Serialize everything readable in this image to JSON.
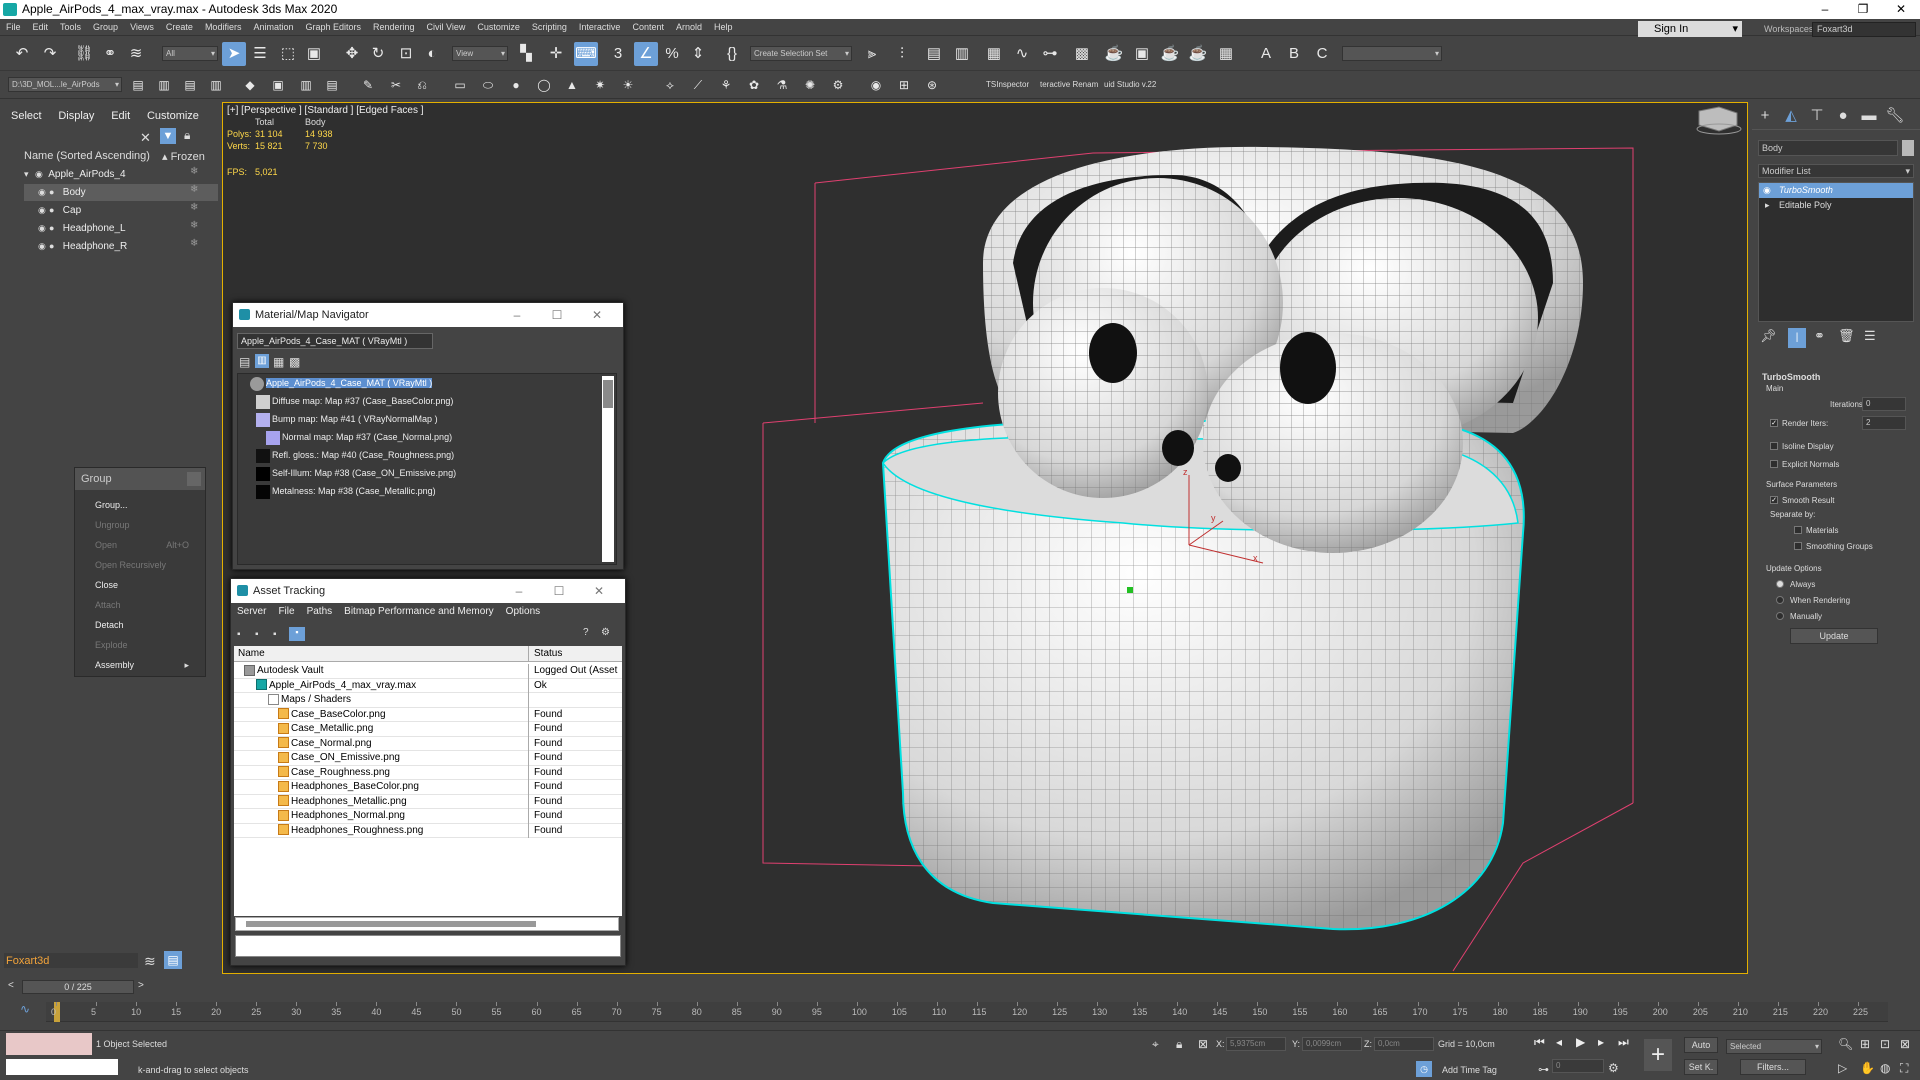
{
  "window": {
    "title": "Apple_AirPods_4_max_vray.max - Autodesk 3ds Max 2020",
    "minimize": "–",
    "restore": "❐",
    "close": "✕"
  },
  "menu": [
    "File",
    "Edit",
    "Tools",
    "Group",
    "Views",
    "Create",
    "Modifiers",
    "Animation",
    "Graph Editors",
    "Rendering",
    "Civil View",
    "Customize",
    "Scripting",
    "Interactive",
    "Content",
    "Arnold",
    "Help"
  ],
  "signin": "Sign In",
  "workspaces": {
    "label": "Workspaces:",
    "value": "Foxart3d"
  },
  "toolbar": {
    "filter": "All",
    "view": "View",
    "selection_set": "Create Selection Set",
    "path": "D:\\3D_MOL...le_AirPods",
    "plugins": [
      "TSInspector",
      "teractive Renam",
      "uid Studio v.22"
    ]
  },
  "scene_explorer": {
    "tabs": [
      "Select",
      "Display",
      "Edit",
      "Customize"
    ],
    "col_name": "Name (Sorted Ascending)",
    "col_frozen": "▴ Frozen",
    "items": [
      "Apple_AirPods_4",
      "Body",
      "Cap",
      "Headphone_L",
      "Headphone_R"
    ],
    "workspace": "Foxart3d"
  },
  "viewport": {
    "label": "[+] [Perspective ] [Standard ] [Edged Faces ]",
    "stats": {
      "total": "Total",
      "body": "Body",
      "polys_label": "Polys:",
      "polys_total": "31 104",
      "polys_body": "14 938",
      "verts_label": "Verts:",
      "verts_total": "15 821",
      "verts_body": "7 730",
      "fps_label": "FPS:",
      "fps": "5,021"
    },
    "axes": {
      "x": "x",
      "y": "y",
      "z": "z"
    }
  },
  "material_navigator": {
    "title": "Material/Map Navigator",
    "field": "Apple_AirPods_4_Case_MAT  ( VRayMtl )",
    "items": [
      "Apple_AirPods_4_Case_MAT  ( VRayMtl )",
      "Diffuse map: Map #37 (Case_BaseColor.png)",
      "Bump map: Map #41  ( VRayNormalMap )",
      "Normal map: Map #37 (Case_Normal.png)",
      "Refl. gloss.: Map #40 (Case_Roughness.png)",
      "Self-Illum: Map #38 (Case_ON_Emissive.png)",
      "Metalness: Map #38 (Case_Metallic.png)"
    ]
  },
  "asset_tracking": {
    "title": "Asset Tracking",
    "menu": [
      "Server",
      "File",
      "Paths",
      "Bitmap Performance and Memory",
      "Options"
    ],
    "col_name": "Name",
    "col_status": "Status",
    "rows": [
      {
        "name": "Autodesk Vault",
        "status": "Logged Out (Asset"
      },
      {
        "name": "Apple_AirPods_4_max_vray.max",
        "status": "Ok"
      },
      {
        "name": "Maps / Shaders",
        "status": ""
      },
      {
        "name": "Case_BaseColor.png",
        "status": "Found"
      },
      {
        "name": "Case_Metallic.png",
        "status": "Found"
      },
      {
        "name": "Case_Normal.png",
        "status": "Found"
      },
      {
        "name": "Case_ON_Emissive.png",
        "status": "Found"
      },
      {
        "name": "Case_Roughness.png",
        "status": "Found"
      },
      {
        "name": "Headphones_BaseColor.png",
        "status": "Found"
      },
      {
        "name": "Headphones_Metallic.png",
        "status": "Found"
      },
      {
        "name": "Headphones_Normal.png",
        "status": "Found"
      },
      {
        "name": "Headphones_Roughness.png",
        "status": "Found"
      }
    ]
  },
  "group_menu": {
    "title": "Group",
    "items": [
      {
        "label": "Group...",
        "enabled": true
      },
      {
        "label": "Ungroup",
        "enabled": false
      },
      {
        "label": "Open",
        "key": "Alt+O",
        "enabled": false
      },
      {
        "label": "Open Recursively",
        "enabled": false
      },
      {
        "label": "Close",
        "enabled": true
      },
      {
        "label": "Attach",
        "enabled": false
      },
      {
        "label": "Detach",
        "enabled": true
      },
      {
        "label": "Explode",
        "enabled": false
      },
      {
        "label": "Assembly",
        "enabled": true
      }
    ]
  },
  "command_panel": {
    "name": "Body",
    "modifier_list": "Modifier List",
    "stack": [
      "TurboSmooth",
      "Editable Poly"
    ],
    "turbosmooth": {
      "title": "TurboSmooth",
      "main": "Main",
      "iterations_label": "Iterations:",
      "iterations": "0",
      "render_iters_label": "Render Iters:",
      "render_iters": "2",
      "isoline": "Isoline Display",
      "explicit": "Explicit Normals",
      "surface": "Surface Parameters",
      "smooth_result": "Smooth Result",
      "separate_by": "Separate by:",
      "materials": "Materials",
      "smoothing_groups": "Smoothing Groups",
      "update_options": "Update Options",
      "always": "Always",
      "when_rendering": "When Rendering",
      "manually": "Manually",
      "update": "Update"
    }
  },
  "timeline": {
    "slider": "0 / 225",
    "ticks": [
      "0",
      "5",
      "10",
      "15",
      "20",
      "25",
      "30",
      "35",
      "40",
      "45",
      "50",
      "55",
      "60",
      "65",
      "70",
      "75",
      "80",
      "85",
      "90",
      "95",
      "100",
      "105",
      "110",
      "115",
      "120",
      "125",
      "130",
      "135",
      "140",
      "145",
      "150",
      "155",
      "160",
      "165",
      "170",
      "175",
      "180",
      "185",
      "190",
      "195",
      "200",
      "205",
      "210",
      "215",
      "220",
      "225"
    ]
  },
  "status": {
    "selected": "1 Object Selected",
    "hint": "k-and-drag to select objects",
    "x_label": "X:",
    "x": "5,9375cm",
    "y_label": "Y:",
    "y": "0,0099cm",
    "z_label": "Z:",
    "z": "0,0cm",
    "grid": "Grid = 10,0cm",
    "add_time_tag": "Add Time Tag",
    "auto": "Auto",
    "set_key": "Set K.",
    "selected_drop": "Selected",
    "filters": "Filters...",
    "frame": "0"
  },
  "colors": {
    "accent": "#6da0d8",
    "highlight": "#00e0e0",
    "bbox": "#e04070",
    "viewport_border": "#e4b000",
    "stats": "#ffd84a"
  }
}
